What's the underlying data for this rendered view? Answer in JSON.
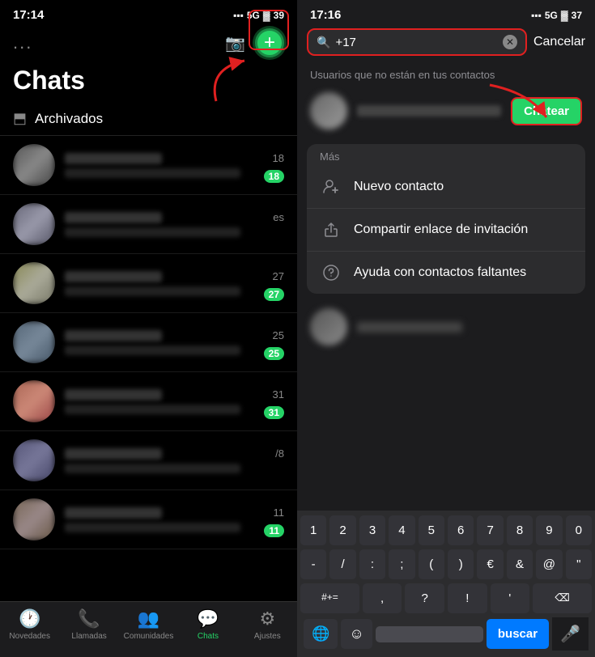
{
  "left": {
    "statusBar": {
      "time": "17:14",
      "signal": "5G",
      "battery": "39"
    },
    "topIcons": {
      "dots": "...",
      "camera": "⊡",
      "add": "+"
    },
    "pageTitle": "Chats",
    "archivedLabel": "Archivados",
    "chats": [
      {
        "time": "18",
        "badge": "18"
      },
      {
        "time": "es",
        "badge": null
      },
      {
        "time": "27",
        "badge": "27"
      },
      {
        "time": "25",
        "badge": "25"
      },
      {
        "time": "31",
        "badge": "31"
      },
      {
        "time": "/8",
        "badge": null
      },
      {
        "time": "11",
        "badge": "11"
      }
    ],
    "bottomNav": [
      {
        "icon": "🕐",
        "label": "Novedades",
        "active": false
      },
      {
        "icon": "📞",
        "label": "Llamadas",
        "active": false
      },
      {
        "icon": "👥",
        "label": "Comunidades",
        "active": false
      },
      {
        "icon": "💬",
        "label": "Chats",
        "active": true
      },
      {
        "icon": "⚙",
        "label": "Ajustes",
        "active": false
      }
    ]
  },
  "right": {
    "statusBar": {
      "time": "17:16",
      "signal": "5G",
      "battery": "37"
    },
    "searchBar": {
      "value": "+17",
      "clearIcon": "✕",
      "cancelLabel": "Cancelar"
    },
    "sectionLabel": "Usuarios que no están en tus contactos",
    "chatearLabel": "Chatear",
    "mas": {
      "label": "Más",
      "items": [
        {
          "icon": "👤+",
          "label": "Nuevo contacto"
        },
        {
          "icon": "⎙",
          "label": "Compartir enlace de invitación"
        },
        {
          "icon": "?",
          "label": "Ayuda con contactos faltantes"
        }
      ]
    },
    "keyboard": {
      "row1": [
        "1",
        "2",
        "3",
        "4",
        "5",
        "6",
        "7",
        "8",
        "9",
        "0"
      ],
      "row2": [
        "-",
        "/",
        ":",
        ";",
        " ( ",
        " ) ",
        "€",
        "&",
        "@",
        "\""
      ],
      "row2symbols": [
        "#+=",
        ",",
        " ? ",
        "!",
        "'",
        "⌫"
      ],
      "bottomRow": {
        "globeIcon": "🌐",
        "emojiIcon": "☺",
        "spaceLabel": "",
        "buscarLabel": "buscar",
        "micIcon": "🎤"
      }
    }
  }
}
